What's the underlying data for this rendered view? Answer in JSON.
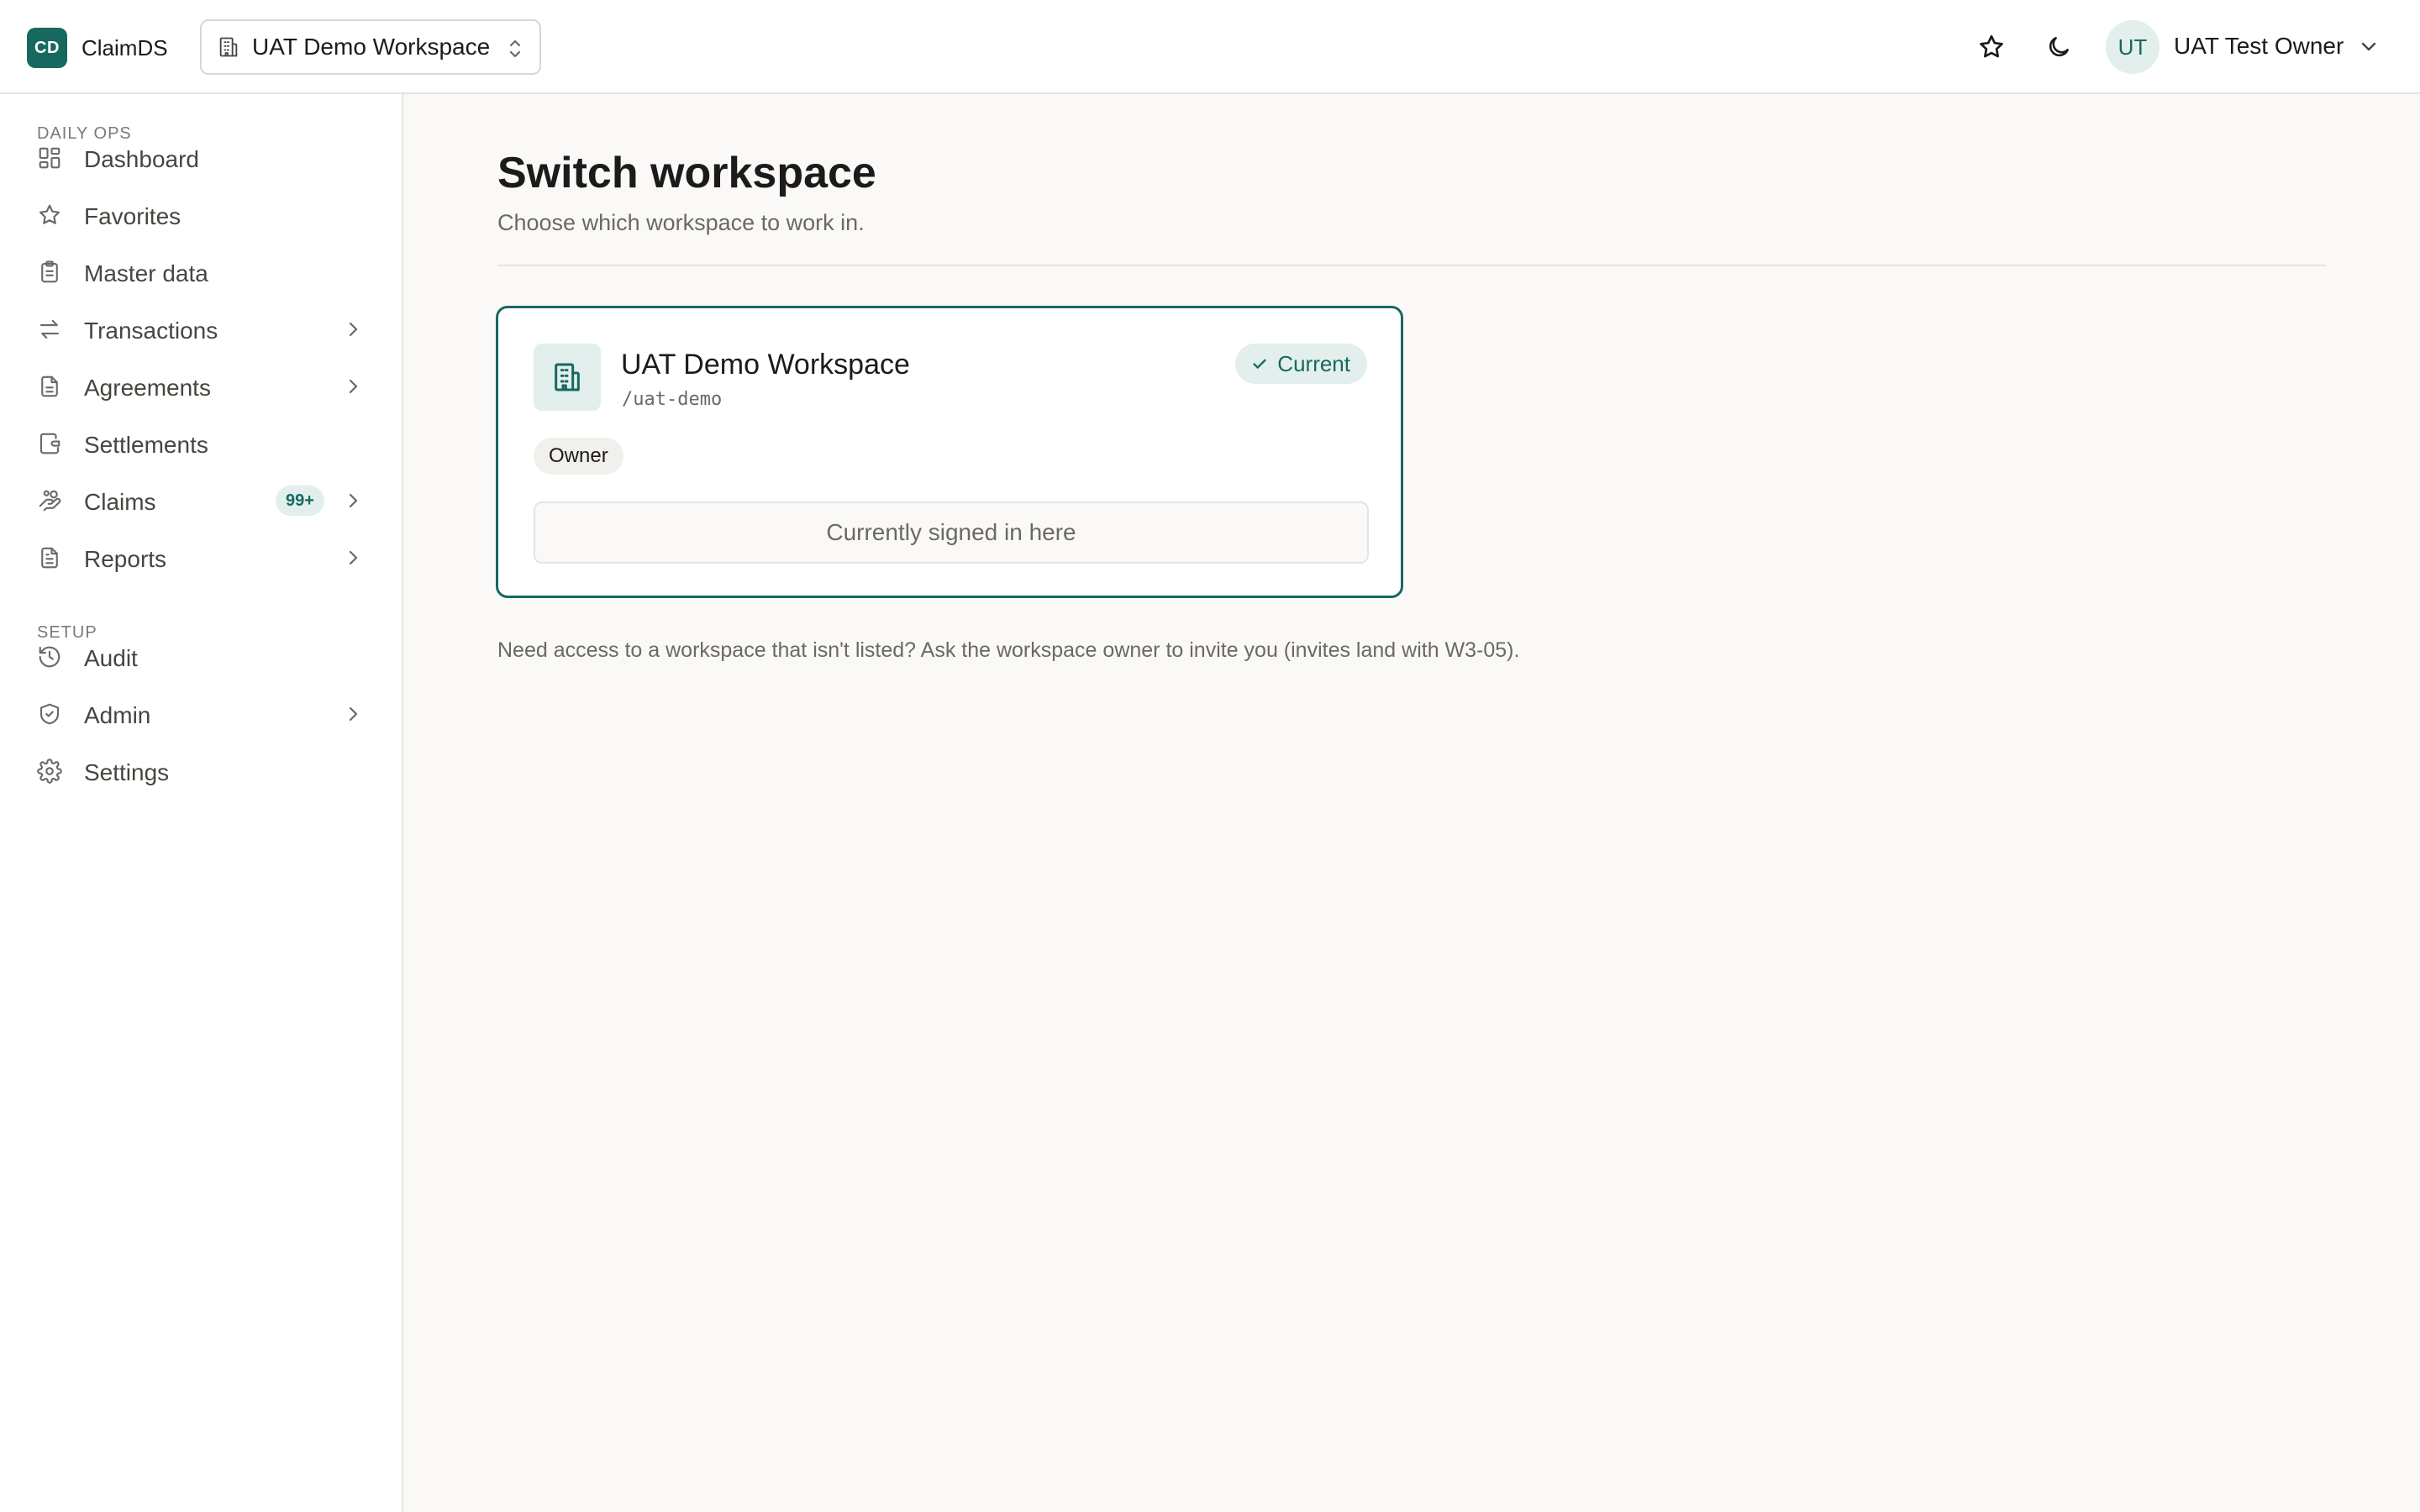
{
  "app": {
    "logo_text": "CD",
    "name": "ClaimDS",
    "accent_color": "#17695f"
  },
  "header": {
    "workspace_switcher_label": "UAT Demo Workspace",
    "favorites_icon": "star-icon",
    "theme_toggle_icon": "moon-icon",
    "user": {
      "initials": "UT",
      "name": "UAT Test Owner"
    }
  },
  "sidebar": {
    "sections": [
      {
        "title": "DAILY OPS",
        "items": [
          {
            "label": "Dashboard",
            "icon": "dashboard-icon",
            "has_children": false
          },
          {
            "label": "Favorites",
            "icon": "star-icon",
            "has_children": false
          },
          {
            "label": "Master data",
            "icon": "clipboard-icon",
            "has_children": false
          },
          {
            "label": "Transactions",
            "icon": "arrows-exchange-icon",
            "has_children": true
          },
          {
            "label": "Agreements",
            "icon": "document-icon",
            "has_children": true
          },
          {
            "label": "Settlements",
            "icon": "wallet-icon",
            "has_children": false
          },
          {
            "label": "Claims",
            "icon": "hand-coins-icon",
            "has_children": true,
            "badge": "99+"
          },
          {
            "label": "Reports",
            "icon": "report-icon",
            "has_children": true
          }
        ]
      },
      {
        "title": "SETUP",
        "items": [
          {
            "label": "Audit",
            "icon": "history-icon",
            "has_children": false
          },
          {
            "label": "Admin",
            "icon": "shield-check-icon",
            "has_children": true
          },
          {
            "label": "Settings",
            "icon": "gear-icon",
            "has_children": false
          }
        ]
      }
    ]
  },
  "main": {
    "title": "Switch workspace",
    "subtitle": "Choose which workspace to work in.",
    "workspace_card": {
      "name": "UAT Demo Workspace",
      "slug": "/uat-demo",
      "status_badge": "Current",
      "role": "Owner",
      "action_label": "Currently signed in here"
    },
    "help_text": "Need access to a workspace that isn't listed? Ask the workspace owner to invite you (invites land with W3-05)."
  }
}
